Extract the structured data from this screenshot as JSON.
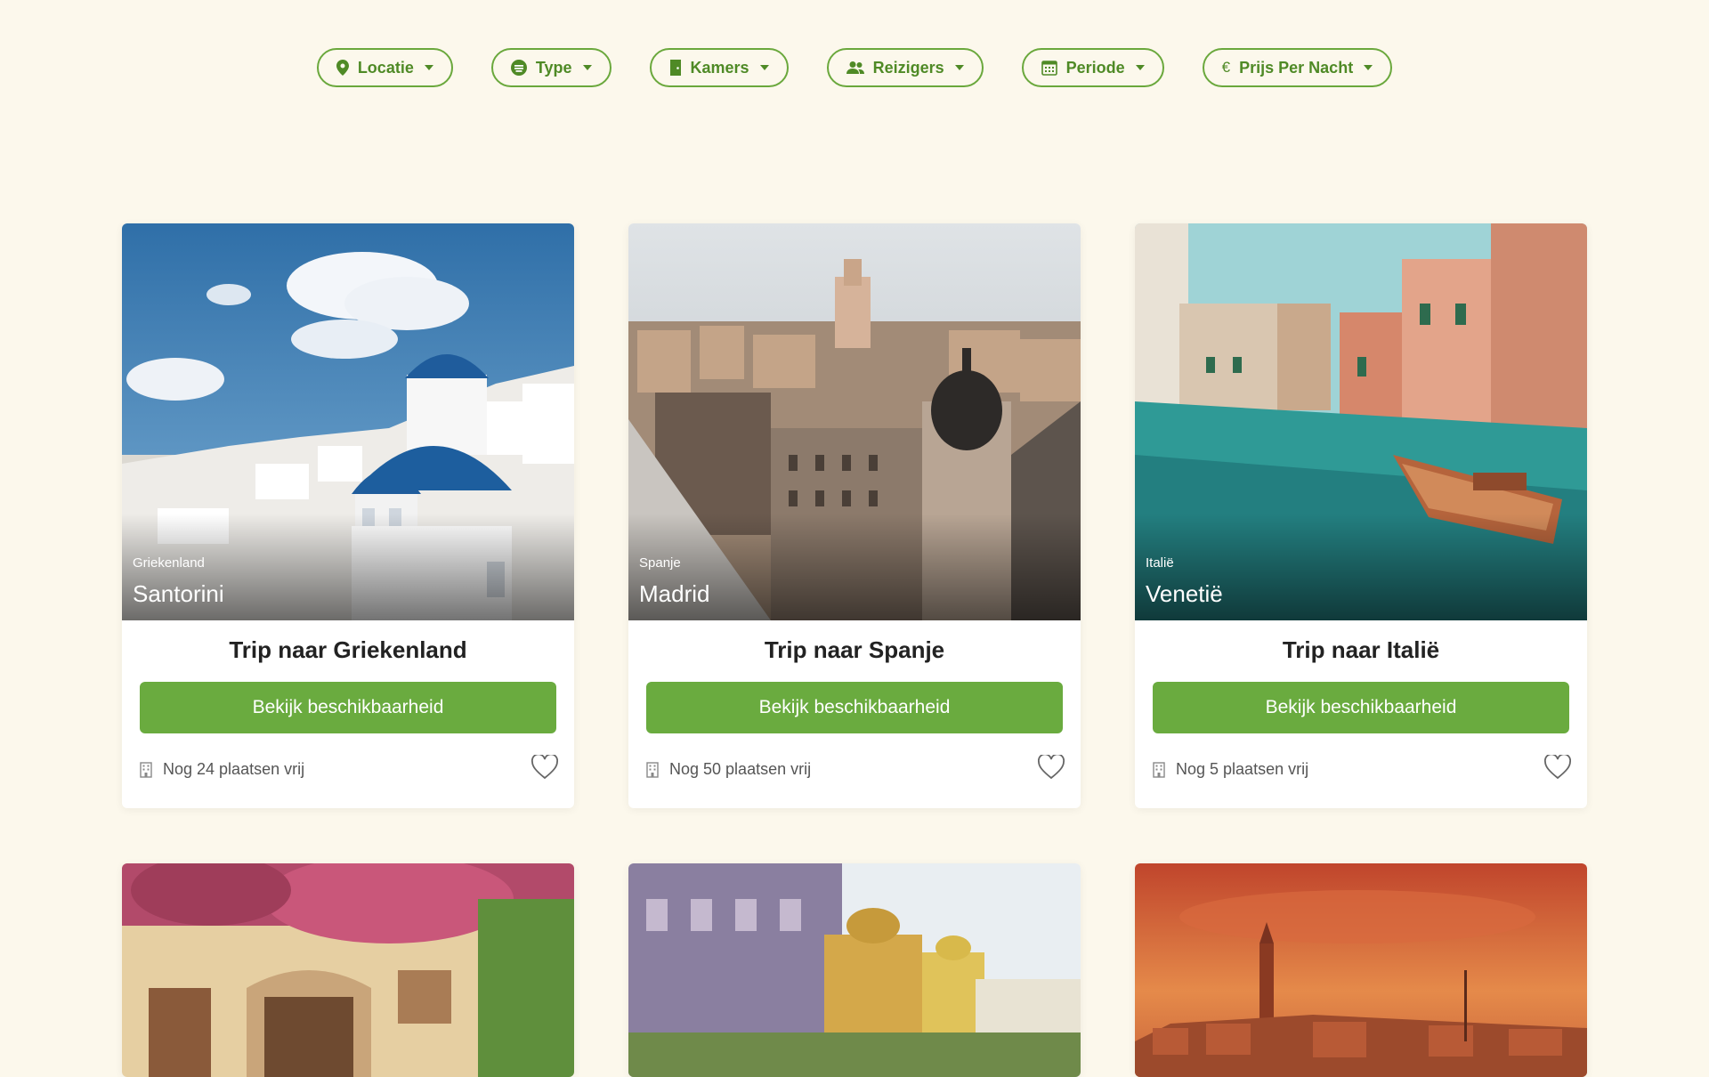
{
  "colors": {
    "accent": "#6aab3f",
    "background": "#fcf8ec"
  },
  "filters": [
    {
      "label": "Locatie",
      "icon": "location-pin-icon"
    },
    {
      "label": "Type",
      "icon": "type-list-icon"
    },
    {
      "label": "Kamers",
      "icon": "door-icon"
    },
    {
      "label": "Reizigers",
      "icon": "users-icon"
    },
    {
      "label": "Periode",
      "icon": "calendar-icon"
    },
    {
      "label": "Prijs Per Nacht",
      "icon": "euro-icon"
    }
  ],
  "cards": [
    {
      "country": "Griekenland",
      "city": "Santorini",
      "title": "Trip naar Griekenland",
      "button": "Bekijk beschikbaarheid",
      "availability": "Nog 24 plaatsen vrij"
    },
    {
      "country": "Spanje",
      "city": "Madrid",
      "title": "Trip naar Spanje",
      "button": "Bekijk beschikbaarheid",
      "availability": "Nog 50 plaatsen vrij"
    },
    {
      "country": "Italië",
      "city": "Venetië",
      "title": "Trip naar Italië",
      "button": "Bekijk beschikbaarheid",
      "availability": "Nog 5 plaatsen vrij"
    }
  ]
}
